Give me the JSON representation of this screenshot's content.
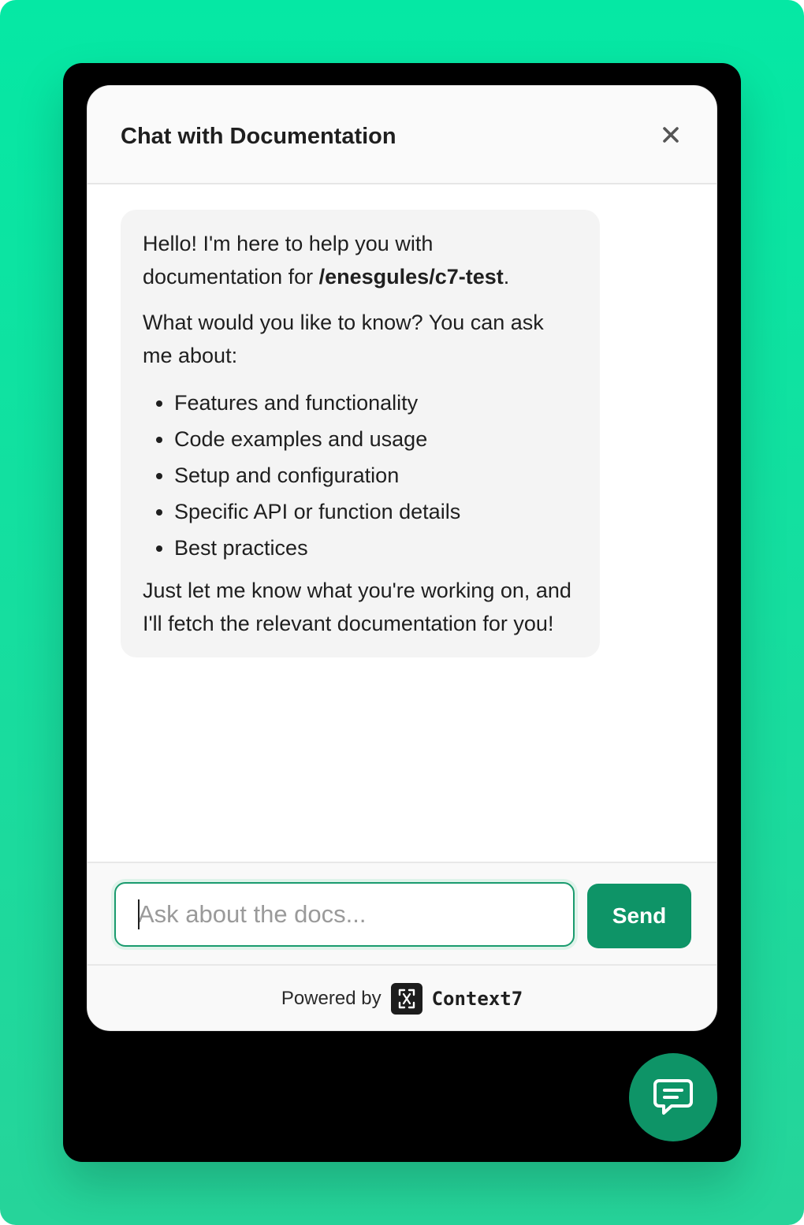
{
  "header": {
    "title": "Chat with Documentation",
    "close_icon": "close-icon"
  },
  "message": {
    "greeting_prefix": "Hello! I'm here to help you with documentation for ",
    "repo": "/enesgules/c7-test",
    "greeting_suffix": ".",
    "question": "What would you like to know? You can ask me about:",
    "topics": [
      "Features and functionality",
      "Code examples and usage",
      "Setup and configuration",
      "Specific API or function details",
      "Best practices"
    ],
    "closing": "Just let me know what you're working on, and I'll fetch the relevant documentation for you!"
  },
  "composer": {
    "placeholder": "Ask about the docs...",
    "value": "",
    "send_label": "Send"
  },
  "footer": {
    "powered_label": "Powered by",
    "brand_name": "Context7",
    "brand_icon": "context7-logo-icon"
  },
  "launcher": {
    "icon": "chat-bubble-icon"
  },
  "colors": {
    "accent": "#0e9467",
    "backdrop": "#05e8a4",
    "frame": "#000000"
  }
}
